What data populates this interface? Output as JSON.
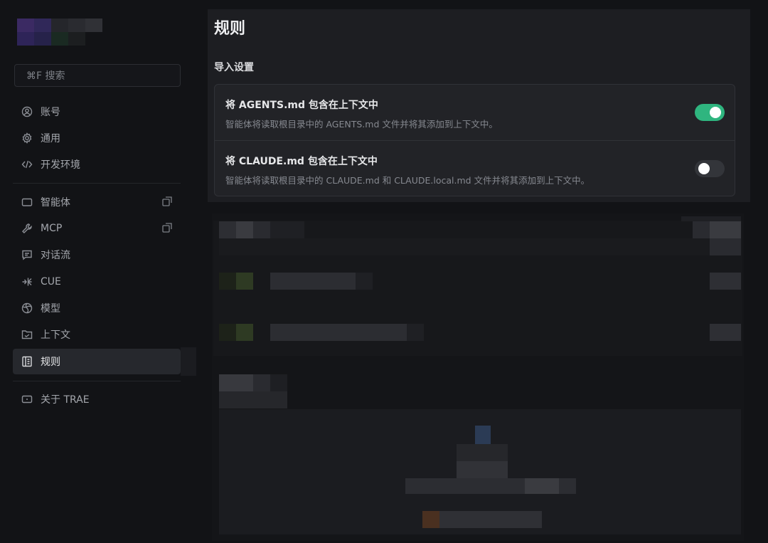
{
  "sidebar": {
    "search_label": "⌘F 搜索",
    "items": [
      {
        "label": "账号",
        "icon": "user-icon"
      },
      {
        "label": "通用",
        "icon": "gear-icon"
      },
      {
        "label": "开发环境",
        "icon": "code-icon"
      },
      {
        "label": "智能体",
        "icon": "agent-icon",
        "external": true
      },
      {
        "label": "MCP",
        "icon": "wrench-icon",
        "external": true
      },
      {
        "label": "对话流",
        "icon": "chat-icon"
      },
      {
        "label": "CUE",
        "icon": "cue-icon"
      },
      {
        "label": "模型",
        "icon": "model-icon"
      },
      {
        "label": "上下文",
        "icon": "folder-icon"
      },
      {
        "label": "规则",
        "icon": "rules-icon",
        "active": true
      },
      {
        "label": "关于 TRAE",
        "icon": "about-icon"
      }
    ]
  },
  "main": {
    "title": "规则",
    "section_title": "导入设置",
    "settings": [
      {
        "title": "将 AGENTS.md 包含在上下文中",
        "description": "智能体将读取根目录中的 AGENTS.md 文件并将其添加到上下文中。",
        "enabled": true
      },
      {
        "title": "将 CLAUDE.md 包含在上下文中",
        "description": "智能体将读取根目录中的 CLAUDE.md 和 CLAUDE.local.md 文件并将其添加到上下文中。",
        "enabled": false
      }
    ]
  },
  "colors": {
    "accent_toggle_on": "#2fb57f",
    "background": "#121316",
    "panel": "#1d1e22"
  }
}
